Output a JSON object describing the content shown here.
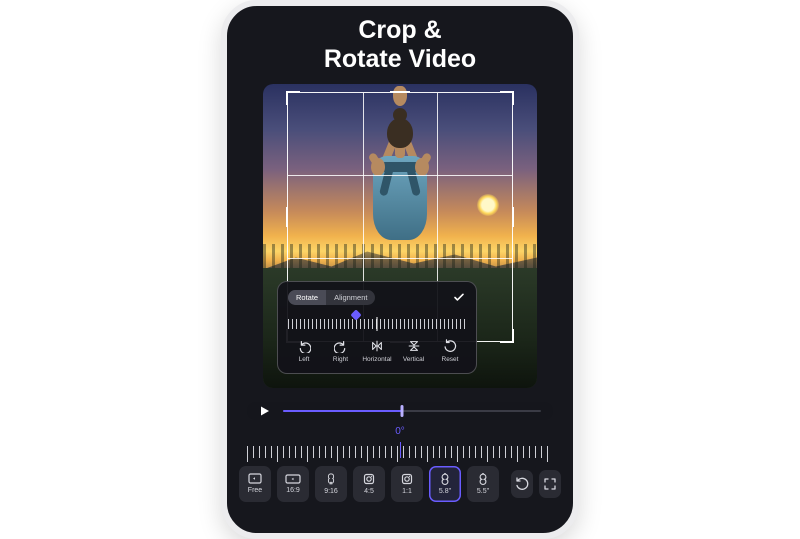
{
  "screen_title": "Crop &\nRotate Video",
  "panel": {
    "tabs": {
      "rotate": "Rotate",
      "alignment": "Alignment"
    },
    "dial_indicator_percent": 38,
    "buttons": {
      "left": "Left",
      "right": "Right",
      "horizontal": "Horizontal",
      "vertical": "Vertical",
      "reset": "Reset"
    }
  },
  "player": {
    "progress_percent": 46
  },
  "ruler": {
    "center_label": "0°"
  },
  "ratios": {
    "free": "Free",
    "r16_9": "16:9",
    "r9_16": "9:16",
    "r4_5": "4:5",
    "r1_1": "1:1",
    "r58": "5.8\"",
    "r55": "5.5\""
  },
  "colors": {
    "accent": "#6a5cff",
    "panel_bg": "#16171d"
  }
}
